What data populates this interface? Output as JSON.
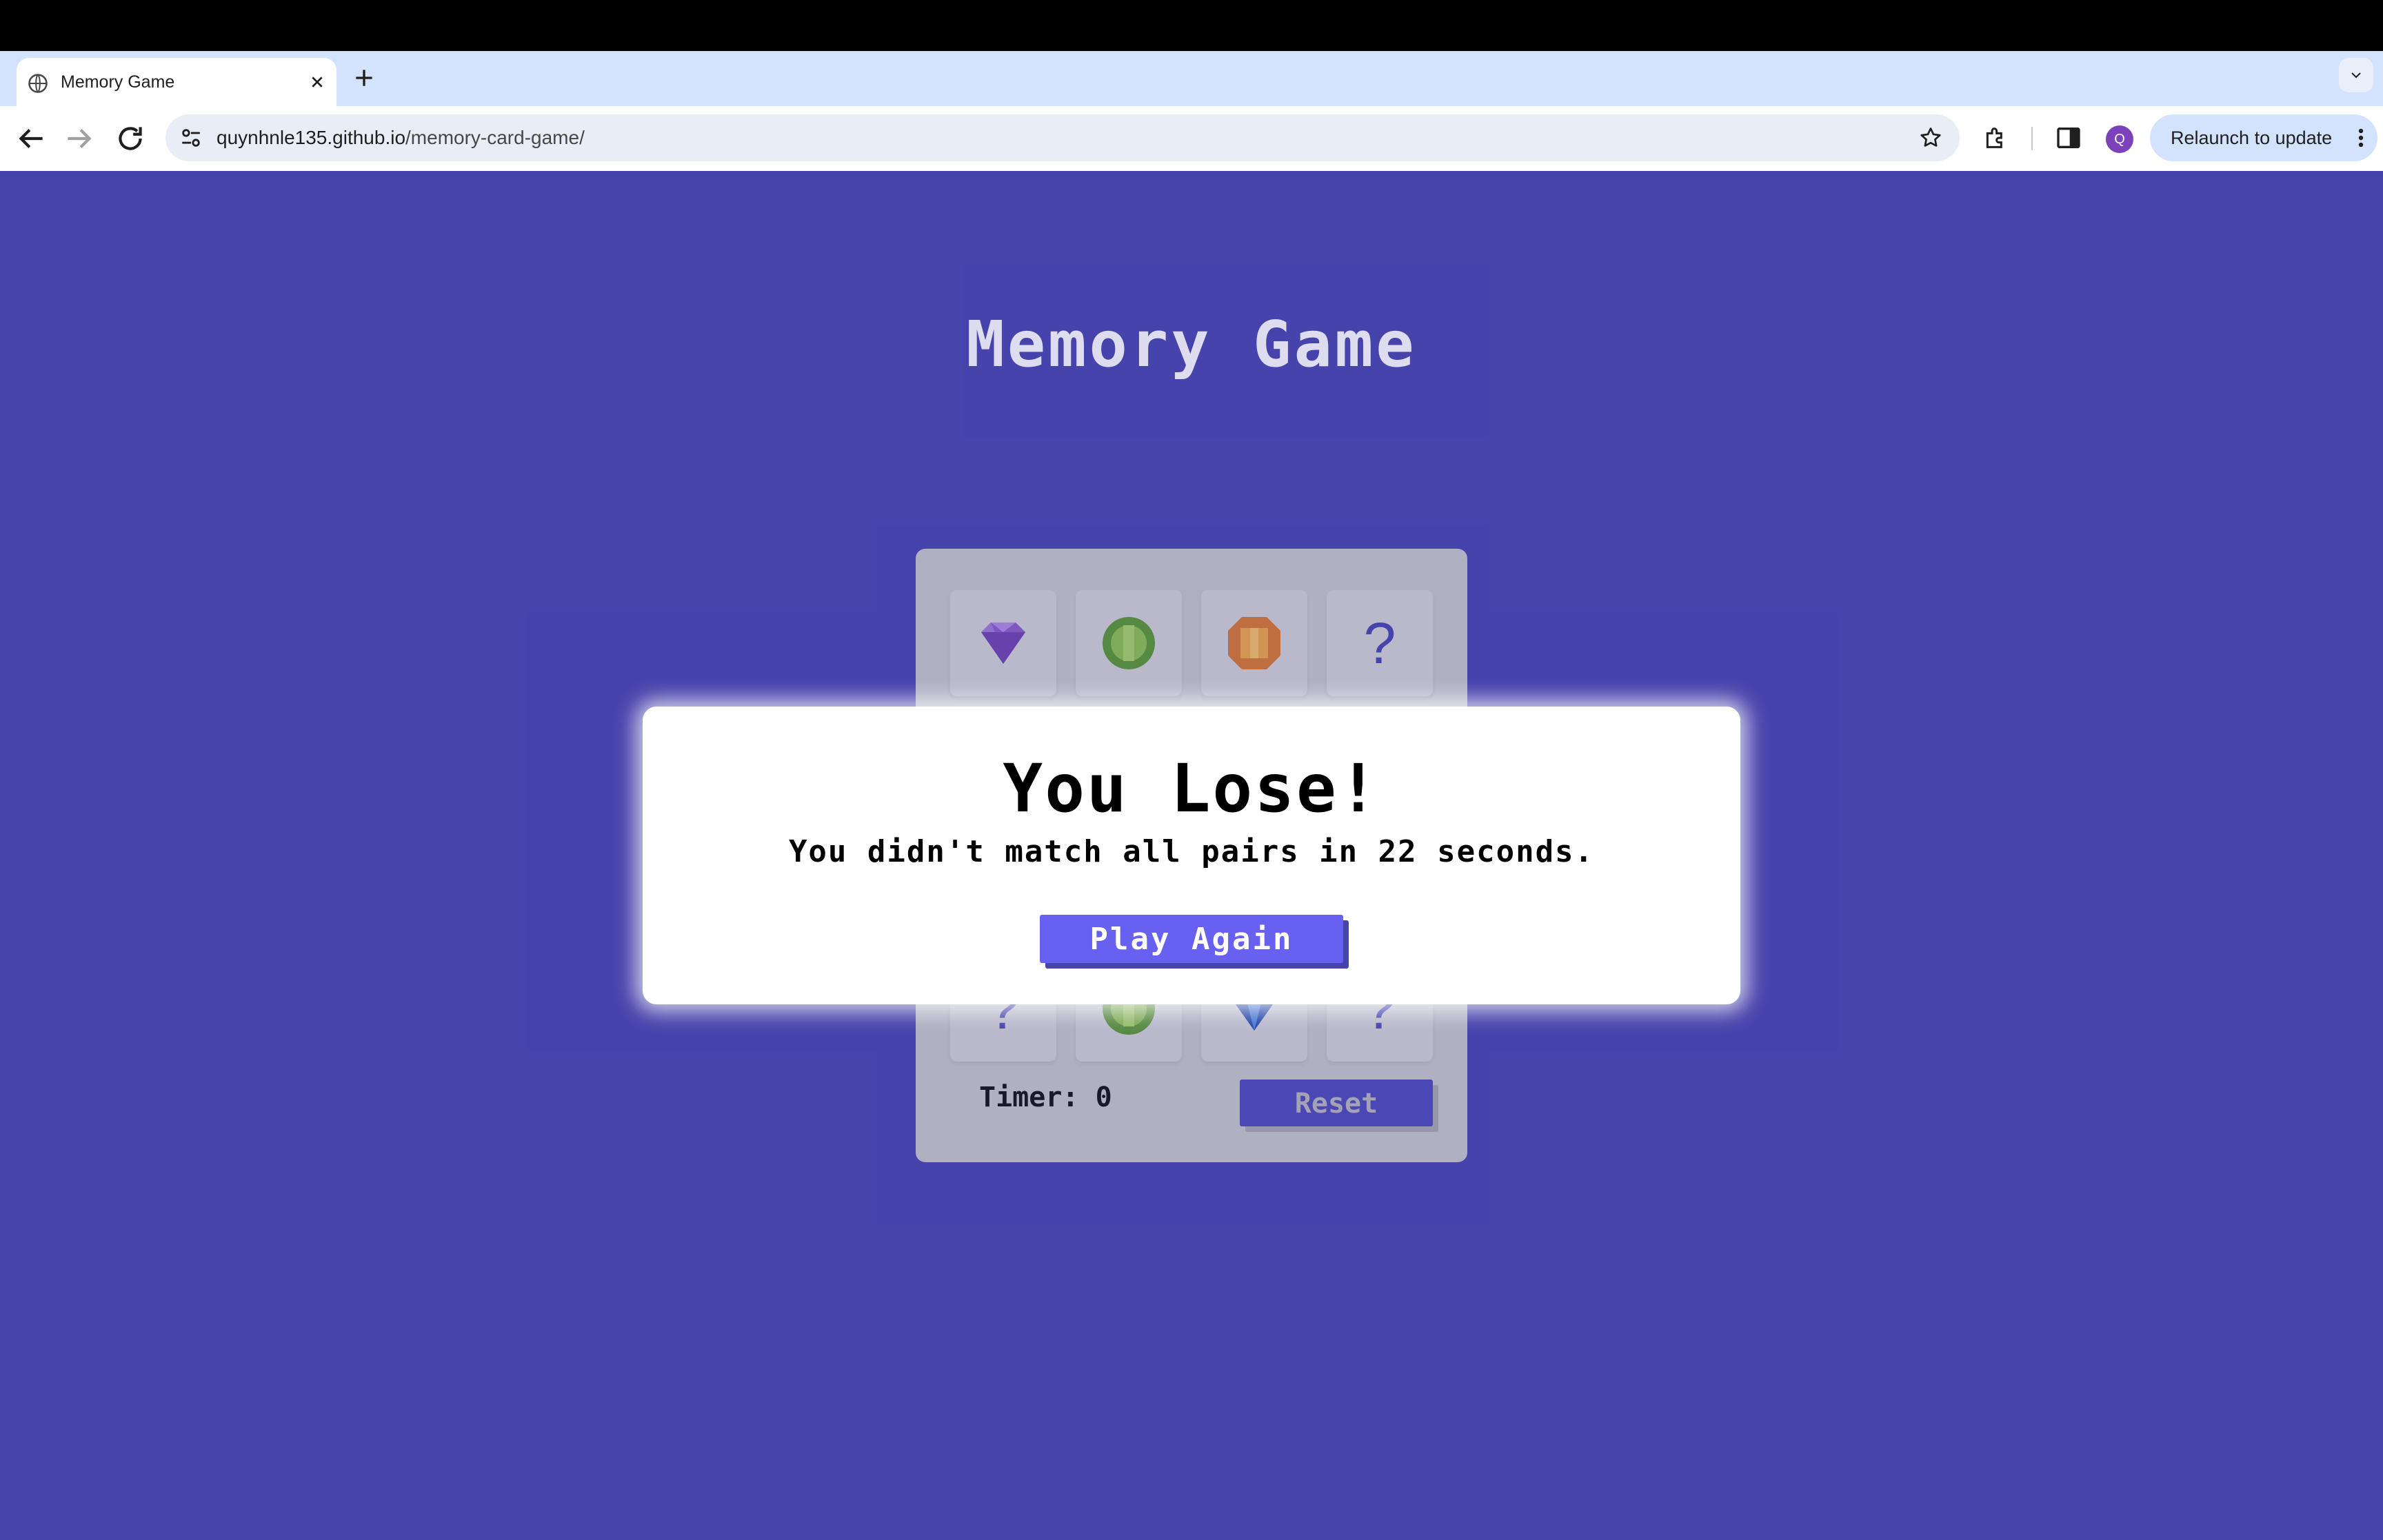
{
  "browser": {
    "tab_title": "Memory Game",
    "url_host": "quynhnle135.github.io",
    "url_path": "/memory-card-game/",
    "profile_initial": "Q",
    "relaunch_label": "Relaunch to update"
  },
  "game": {
    "title": "Memory Game",
    "timer_label": "Timer: 0",
    "reset_label": "Reset",
    "hidden_card_symbol": "?",
    "cards_row1": [
      "amethyst-gem",
      "green-gem",
      "orange-gem",
      "hidden"
    ],
    "cards_row4": [
      "hidden",
      "green-gem",
      "blue-gem",
      "hidden"
    ]
  },
  "modal": {
    "title": "You Lose!",
    "message": "You didn't match all pairs in 22 seconds.",
    "button_label": "Play Again"
  },
  "colors": {
    "page_background": "#4744ac",
    "board_background": "#c8c8c8",
    "button_primary": "#6860f0"
  }
}
